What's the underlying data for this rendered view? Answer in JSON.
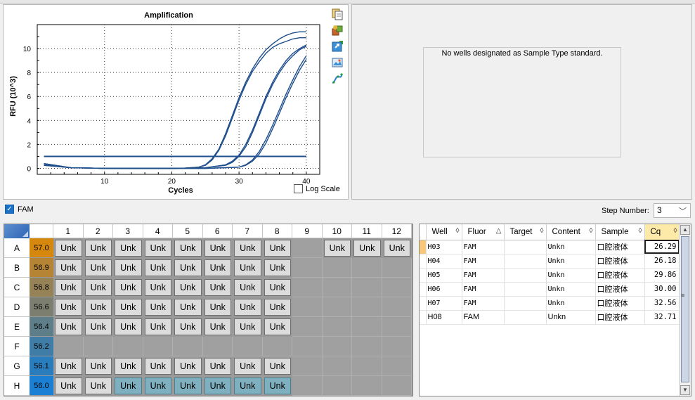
{
  "chart": {
    "title": "Amplification",
    "xlabel": "Cycles",
    "ylabel": "RFU (10^3)",
    "log_scale_label": "Log Scale",
    "toolbar_icons": [
      "copy-icon",
      "export-icon",
      "refresh-icon",
      "image-icon",
      "curve-icon"
    ]
  },
  "chart_data": {
    "type": "line",
    "title": "Amplification",
    "xlabel": "Cycles",
    "ylabel": "RFU (10^3)",
    "xlim": [
      0,
      42
    ],
    "ylim": [
      -0.5,
      12
    ],
    "xticks": [
      10,
      20,
      30,
      40
    ],
    "yticks": [
      0,
      2,
      4,
      6,
      8,
      10
    ],
    "grid": true,
    "line_color": "#1f4e8c",
    "threshold": 1.0,
    "series": [
      {
        "x": [
          1,
          5,
          10,
          15,
          20,
          22,
          24,
          25,
          26,
          27,
          28,
          29,
          30,
          31,
          32,
          33,
          34,
          35,
          36,
          37,
          38,
          39,
          40
        ],
        "values": [
          0.4,
          0.05,
          0,
          0,
          0,
          0.02,
          0.1,
          0.3,
          0.8,
          1.6,
          2.9,
          4.4,
          5.9,
          7.2,
          8.3,
          9.2,
          9.9,
          10.4,
          10.8,
          11.1,
          11.3,
          11.4,
          11.4
        ]
      },
      {
        "x": [
          1,
          5,
          10,
          15,
          20,
          22,
          24,
          25,
          26,
          27,
          28,
          29,
          30,
          31,
          32,
          33,
          34,
          35,
          36,
          37,
          38,
          39,
          40
        ],
        "values": [
          0.4,
          0.05,
          0,
          0,
          0,
          0.02,
          0.1,
          0.25,
          0.7,
          1.5,
          2.7,
          4.2,
          5.7,
          7.0,
          8.1,
          8.9,
          9.6,
          10.1,
          10.4,
          10.6,
          10.8,
          10.9,
          10.9
        ]
      },
      {
        "x": [
          1,
          5,
          10,
          15,
          20,
          25,
          28,
          29,
          30,
          31,
          32,
          33,
          34,
          35,
          36,
          37,
          38,
          39,
          40
        ],
        "values": [
          0.3,
          0.05,
          0,
          0,
          0,
          0.05,
          0.3,
          0.6,
          1.1,
          2.0,
          3.2,
          4.6,
          6.0,
          7.2,
          8.2,
          9.0,
          9.6,
          10.0,
          10.3
        ]
      },
      {
        "x": [
          1,
          5,
          10,
          15,
          20,
          25,
          28,
          29,
          30,
          31,
          32,
          33,
          34,
          35,
          36,
          37,
          38,
          39,
          40
        ],
        "values": [
          0.3,
          0.05,
          0,
          0,
          0,
          0.05,
          0.25,
          0.5,
          1.0,
          1.8,
          3.0,
          4.4,
          5.8,
          7.0,
          8.0,
          8.8,
          9.4,
          9.9,
          10.2
        ]
      },
      {
        "x": [
          1,
          5,
          10,
          15,
          20,
          25,
          30,
          31,
          32,
          33,
          34,
          35,
          36,
          37,
          38,
          39,
          40
        ],
        "values": [
          0.25,
          0.05,
          0,
          0,
          0,
          0,
          0.1,
          0.3,
          0.7,
          1.4,
          2.4,
          3.6,
          4.9,
          6.2,
          7.4,
          8.5,
          9.4
        ]
      },
      {
        "x": [
          1,
          5,
          10,
          15,
          20,
          25,
          30,
          31,
          32,
          33,
          34,
          35,
          36,
          37,
          38,
          39,
          40
        ],
        "values": [
          0.25,
          0.05,
          0,
          0,
          0,
          0,
          0.1,
          0.25,
          0.6,
          1.2,
          2.1,
          3.3,
          4.6,
          5.9,
          7.1,
          8.2,
          9.1
        ]
      }
    ]
  },
  "standard": {
    "message": "No wells designated as Sample Type standard."
  },
  "fluor": {
    "fam_label": "FAM",
    "fam_checked": true,
    "step_label": "Step Number:",
    "step_value": "3"
  },
  "plate": {
    "columns": [
      "1",
      "2",
      "3",
      "4",
      "5",
      "6",
      "7",
      "8",
      "9",
      "10",
      "11",
      "12"
    ],
    "rows": [
      {
        "label": "A",
        "temp": "57.0",
        "color": "#d6870e",
        "wells": [
          "Unk",
          "Unk",
          "Unk",
          "Unk",
          "Unk",
          "Unk",
          "Unk",
          "Unk",
          "",
          "Unk",
          "Unk",
          "Unk"
        ],
        "selected": []
      },
      {
        "label": "B",
        "temp": "56.9",
        "color": "#b58434",
        "wells": [
          "Unk",
          "Unk",
          "Unk",
          "Unk",
          "Unk",
          "Unk",
          "Unk",
          "Unk",
          "",
          "",
          "",
          ""
        ],
        "selected": []
      },
      {
        "label": "C",
        "temp": "56.8",
        "color": "#968257",
        "wells": [
          "Unk",
          "Unk",
          "Unk",
          "Unk",
          "Unk",
          "Unk",
          "Unk",
          "Unk",
          "",
          "",
          "",
          ""
        ],
        "selected": []
      },
      {
        "label": "D",
        "temp": "56.6",
        "color": "#7c7e6f",
        "wells": [
          "Unk",
          "Unk",
          "Unk",
          "Unk",
          "Unk",
          "Unk",
          "Unk",
          "Unk",
          "",
          "",
          "",
          ""
        ],
        "selected": []
      },
      {
        "label": "E",
        "temp": "56.4",
        "color": "#5e7f8a",
        "wells": [
          "Unk",
          "Unk",
          "Unk",
          "Unk",
          "Unk",
          "Unk",
          "Unk",
          "Unk",
          "",
          "",
          "",
          ""
        ],
        "selected": []
      },
      {
        "label": "F",
        "temp": "56.2",
        "color": "#3f7da6",
        "wells": [
          "",
          "",
          "",
          "",
          "",
          "",
          "",
          "",
          "",
          "",
          "",
          ""
        ],
        "selected": []
      },
      {
        "label": "G",
        "temp": "56.1",
        "color": "#2a7dbd",
        "wells": [
          "Unk",
          "Unk",
          "Unk",
          "Unk",
          "Unk",
          "Unk",
          "Unk",
          "Unk",
          "",
          "",
          "",
          ""
        ],
        "selected": []
      },
      {
        "label": "H",
        "temp": "56.0",
        "color": "#1b7fd3",
        "wells": [
          "Unk",
          "Unk",
          "Unk",
          "Unk",
          "Unk",
          "Unk",
          "Unk",
          "Unk",
          "",
          "",
          "",
          ""
        ],
        "selected": [
          2,
          3,
          4,
          5,
          6,
          7
        ]
      }
    ]
  },
  "results": {
    "headers": [
      "Well",
      "Fluor",
      "Target",
      "Content",
      "Sample",
      "Cq"
    ],
    "rows": [
      {
        "well": "H03",
        "fluor": "FAM",
        "target": "",
        "content": "Unkn",
        "sample": "口腔液体",
        "cq": "26.29",
        "mono": true
      },
      {
        "well": "H04",
        "fluor": "FAM",
        "target": "",
        "content": "Unkn",
        "sample": "口腔液体",
        "cq": "26.18",
        "mono": true
      },
      {
        "well": "H05",
        "fluor": "FAM",
        "target": "",
        "content": "Unkn",
        "sample": "口腔液体",
        "cq": "29.86",
        "mono": true
      },
      {
        "well": "H06",
        "fluor": "FAM",
        "target": "",
        "content": "Unkn",
        "sample": "口腔液体",
        "cq": "30.00",
        "mono": true
      },
      {
        "well": "H07",
        "fluor": "FAM",
        "target": "",
        "content": "Unkn",
        "sample": "口腔液体",
        "cq": "32.56",
        "mono": true
      },
      {
        "well": "H08",
        "fluor": "FAM",
        "target": "",
        "content": "Unkn",
        "sample": "口腔液体",
        "cq": "32.71",
        "mono": false
      }
    ]
  }
}
